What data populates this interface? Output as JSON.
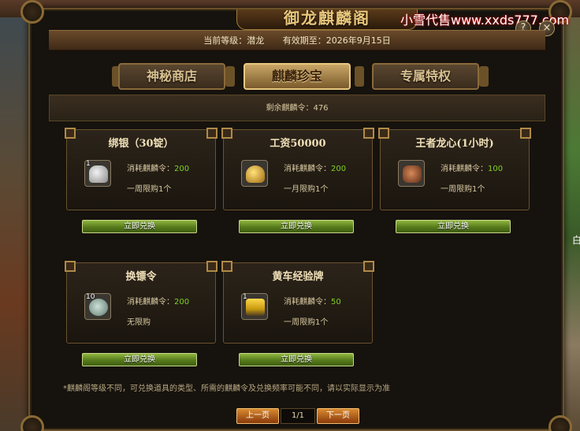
{
  "window": {
    "title": "御龙麒麟阁",
    "watermark": "小雪代售www.xxds777.com",
    "help_label": "?",
    "close_label": "×",
    "side_text": "白"
  },
  "info": {
    "level_text": "当前等级：潜龙",
    "expiry_text": "有效期至：2026年9月15日"
  },
  "tabs": [
    {
      "label": "神秘商店",
      "active": false
    },
    {
      "label": "麒麟珍宝",
      "active": true
    },
    {
      "label": "专属特权",
      "active": false
    }
  ],
  "remaining": "剩余麒麟令：476",
  "items": [
    {
      "title": "绑银（30锭）",
      "count": "1",
      "cost_label": "消耗麒麟令：",
      "cost": "200",
      "limit": "一周限购1个",
      "button": "立即兑换",
      "icon": "silver-ingot-icon"
    },
    {
      "title": "工资50000",
      "count": "",
      "cost_label": "消耗麒麟令：",
      "cost": "200",
      "limit": "一月限购1个",
      "button": "立即兑换",
      "icon": "gold-ingot-icon"
    },
    {
      "title": "王者龙心(1小时)",
      "count": "",
      "cost_label": "消耗麒麟令：",
      "cost": "100",
      "limit": "一周限购1个",
      "button": "立即兑换",
      "icon": "dragon-heart-icon"
    },
    {
      "title": "换镖令",
      "count": "10",
      "cost_label": "消耗麒麟令：",
      "cost": "200",
      "limit": "无限购",
      "button": "立即兑换",
      "icon": "escort-token-icon"
    },
    {
      "title": "黄车经验牌",
      "count": "1",
      "cost_label": "消耗麒麟令：",
      "cost": "50",
      "limit": "一周限购1个",
      "button": "立即兑换",
      "icon": "yellow-cart-icon"
    }
  ],
  "note": "*麒麟阁等级不同，可兑换道具的类型、所需的麒麟令及兑换频率可能不同，请以实际显示为准",
  "pager": {
    "prev": "上一页",
    "page": "1/1",
    "next": "下一页"
  },
  "colors": {
    "accent_gold": "#e9c77b",
    "cost_green": "#7ed321",
    "button_green": "#567a1c",
    "page_button_orange": "#d98a30"
  }
}
